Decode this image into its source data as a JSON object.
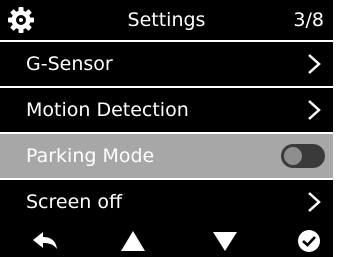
{
  "header": {
    "title": "Settings",
    "page_indicator": "3/8",
    "icon": "gear-icon"
  },
  "menu": {
    "items": [
      {
        "label": "G-Sensor",
        "control": "chevron-right-icon"
      },
      {
        "label": "Motion Detection",
        "control": "chevron-right-icon"
      },
      {
        "label": "Parking Mode",
        "control": "toggle",
        "toggle_on": false,
        "selected": true
      },
      {
        "label": "Screen off",
        "control": "chevron-right-icon"
      }
    ]
  },
  "footer": {
    "buttons": [
      {
        "icon": "back-arrow-icon"
      },
      {
        "icon": "up-triangle-icon"
      },
      {
        "icon": "down-triangle-icon"
      },
      {
        "icon": "confirm-check-icon"
      }
    ]
  },
  "colors": {
    "background": "#000000",
    "text": "#ffffff",
    "selected_row": "#a7a7a7",
    "toggle_track": "#3a3a3a",
    "toggle_knob": "#8e8e8e"
  }
}
